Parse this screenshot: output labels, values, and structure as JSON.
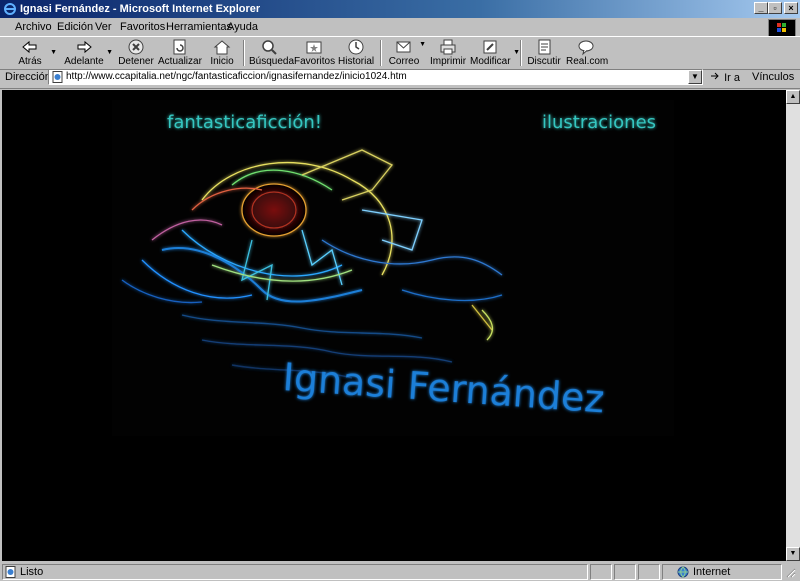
{
  "window": {
    "title": "Ignasi Fernández - Microsoft Internet Explorer"
  },
  "menu": [
    "Archivo",
    "Edición",
    "Ver",
    "Favoritos",
    "Herramientas",
    "Ayuda"
  ],
  "toolbar": [
    {
      "label": "Atrás",
      "icon": "back-arrow-icon"
    },
    {
      "label": "Adelante",
      "icon": "forward-arrow-icon"
    },
    {
      "label": "Detener",
      "icon": "stop-icon"
    },
    {
      "label": "Actualizar",
      "icon": "refresh-icon"
    },
    {
      "label": "Inicio",
      "icon": "home-icon"
    },
    {
      "label": "Búsqueda",
      "icon": "search-icon"
    },
    {
      "label": "Favoritos",
      "icon": "favorites-icon"
    },
    {
      "label": "Historial",
      "icon": "history-icon"
    },
    {
      "label": "Correo",
      "icon": "mail-icon"
    },
    {
      "label": "Imprimir",
      "icon": "print-icon"
    },
    {
      "label": "Modificar",
      "icon": "edit-icon"
    },
    {
      "label": "Discutir",
      "icon": "discuss-icon"
    },
    {
      "label": "Real.com",
      "icon": "realcom-icon"
    }
  ],
  "address": {
    "label": "Dirección",
    "url": "http://www.ccapitalia.net/ngc/fantasticaficcion/ignasifernandez/inicio1024.htm",
    "go_label": "Ir a",
    "links_label": "Vínculos"
  },
  "page": {
    "link_left": "fantasticaficción!",
    "link_right": "ilustraciones",
    "artist_name": "Ignasi Fernández"
  },
  "status": {
    "text": "Listo",
    "zone": "Internet"
  },
  "colors": {
    "title_start": "#0a246a",
    "title_end": "#a6caf0",
    "chrome": "#c0c0c0",
    "page_bg": "#000000",
    "glow_teal": "#36c6c0",
    "glow_blue": "#1e7fd8"
  }
}
